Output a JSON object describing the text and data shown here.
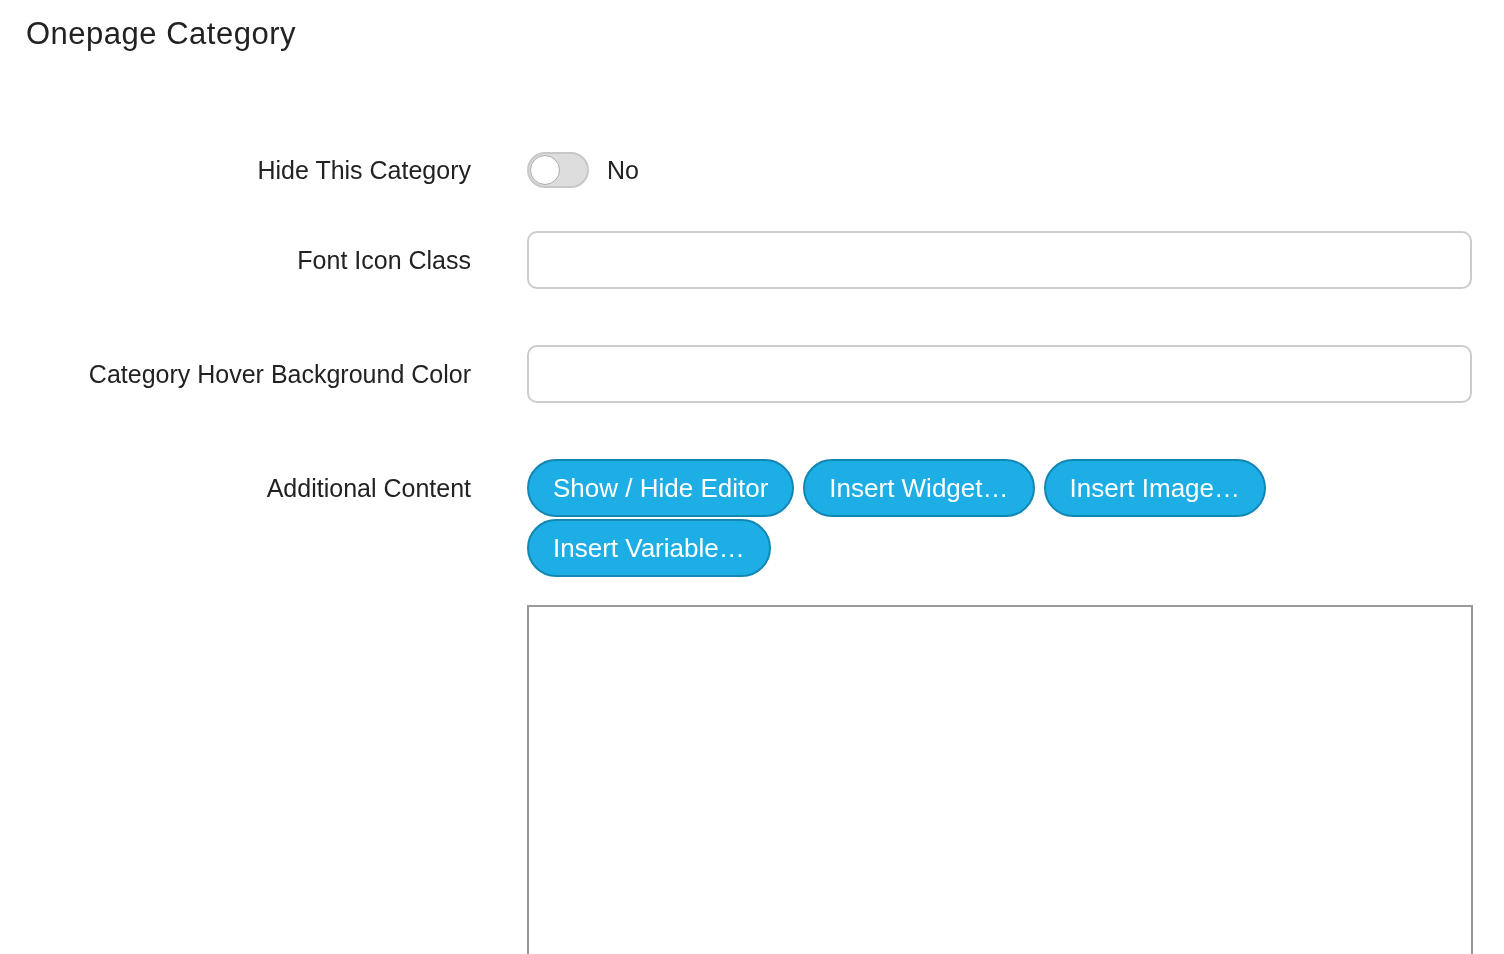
{
  "title": "Onepage Category",
  "fields": [
    {
      "kind": "toggle",
      "label": "Hide This Category",
      "on": false,
      "state_text": "No"
    },
    {
      "kind": "text",
      "label": "Font Icon Class"
    },
    {
      "kind": "text",
      "label": "Category Hover Background Color"
    },
    {
      "kind": "editor",
      "label": "Additional Content",
      "buttons": [
        "Show / Hide Editor",
        "Insert Widget…",
        "Insert Image…",
        "Insert Variable…"
      ]
    }
  ]
}
